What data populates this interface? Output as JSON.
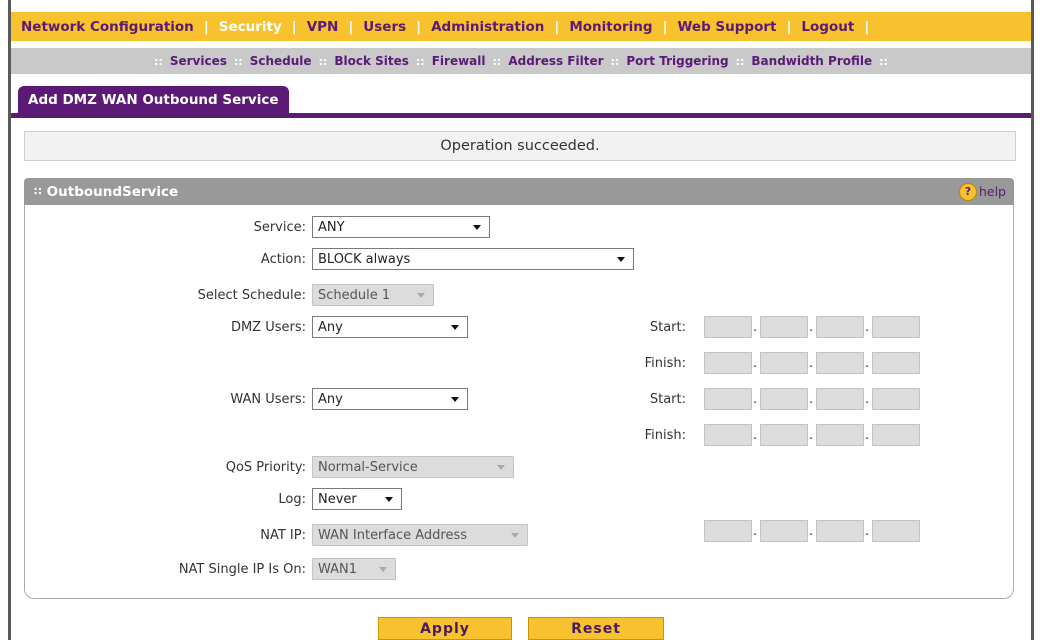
{
  "top_nav": [
    {
      "label": "Network Configuration"
    },
    {
      "label": "Security",
      "active": true
    },
    {
      "label": "VPN"
    },
    {
      "label": "Users"
    },
    {
      "label": "Administration"
    },
    {
      "label": "Monitoring"
    },
    {
      "label": "Web Support"
    },
    {
      "label": "Logout"
    }
  ],
  "sub_nav": [
    "Services",
    "Schedule",
    "Block Sites",
    "Firewall",
    "Address Filter",
    "Port Triggering",
    "Bandwidth Profile"
  ],
  "tab": {
    "title": "Add DMZ WAN Outbound Service"
  },
  "status": {
    "message": "Operation succeeded."
  },
  "section": {
    "title": "OutboundService",
    "help_label": "help",
    "help_icon": "question-circle-icon",
    "grip_icon": "grip-icon"
  },
  "form": {
    "service": {
      "label": "Service:",
      "value": "ANY"
    },
    "action": {
      "label": "Action:",
      "value": "BLOCK always"
    },
    "schedule": {
      "label": "Select Schedule:",
      "value": "Schedule 1"
    },
    "dmz_users": {
      "label": "DMZ Users:",
      "value": "Any"
    },
    "wan_users": {
      "label": "WAN Users:",
      "value": "Any"
    },
    "qos": {
      "label": "QoS Priority:",
      "value": "Normal-Service"
    },
    "log": {
      "label": "Log:",
      "value": "Never"
    },
    "nat_ip": {
      "label": "NAT IP:",
      "value": "WAN Interface Address"
    },
    "nat_single": {
      "label": "NAT Single IP Is On:",
      "value": "WAN1"
    },
    "start_label": "Start:",
    "finish_label": "Finish:"
  },
  "buttons": {
    "apply": "Apply",
    "reset": "Reset"
  },
  "colors": {
    "accent": "#f7c22d",
    "brand": "#5a1a75",
    "subnav": "#c9c9c9",
    "section": "#999999"
  }
}
